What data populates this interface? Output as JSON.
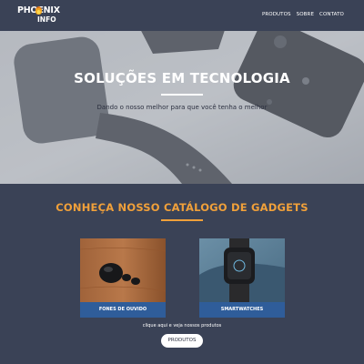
{
  "header": {
    "logo": {
      "line1": "PHOENIX",
      "line2": "INFO"
    },
    "nav": [
      {
        "label": "PRODUTOS"
      },
      {
        "label": "SOBRE"
      },
      {
        "label": "CONTATO"
      }
    ]
  },
  "hero": {
    "title": "SOLUÇÕES EM TECNOLOGIA",
    "subtitle": "Dando o nosso melhor para que você tenha o melhor"
  },
  "catalog": {
    "title": "CONHEÇA NOSSO CATÁLOGO DE GADGETS",
    "cards": [
      {
        "label": "FONES DE OUVIDO",
        "image": "earbuds-photo"
      },
      {
        "label": "SMARTWATCHES",
        "image": "smartwatch-photo"
      }
    ],
    "hint": "clique aqui e veja nossos produtos",
    "button_label": "PRODUTOS"
  },
  "colors": {
    "background": "#3a4256",
    "accent": "#f0a03a",
    "card_caption": "#2f5d9a"
  }
}
